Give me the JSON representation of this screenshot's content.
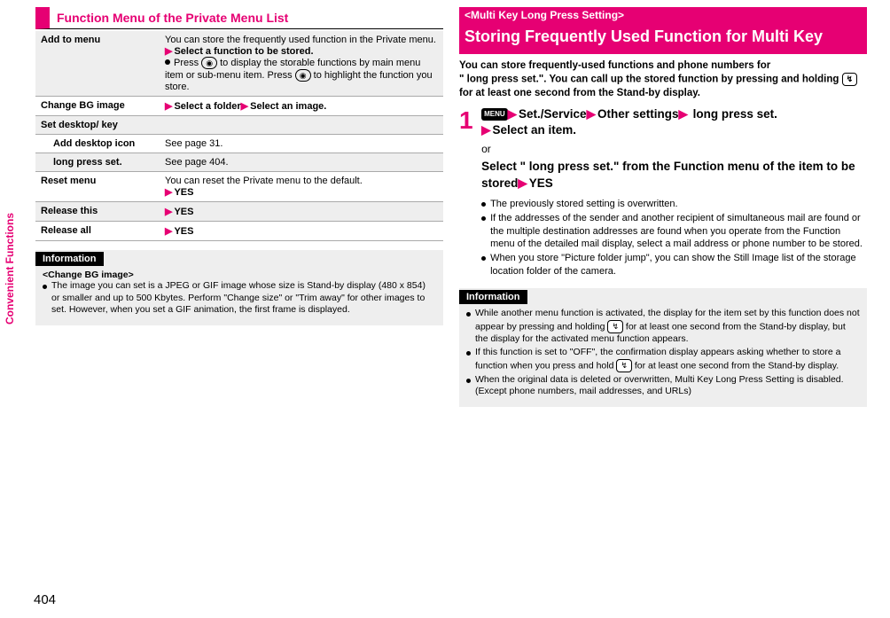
{
  "sidetab": "Convenient Functions",
  "pagenum": "404",
  "left": {
    "section_title": "Function Menu of the Private Menu List",
    "rows": {
      "r1_label": "Add to menu",
      "r1_desc1": "You can store the frequently used function in the Private menu.",
      "r1_action": "Select a function to be stored.",
      "r1_desc2a": "Press ",
      "r1_desc2b": " to display the storable functions by main menu item or sub-menu item. Press ",
      "r1_desc2c": " to highlight the function you store.",
      "r2_label": "Change BG image",
      "r2_act1": "Select a folder",
      "r2_act2": "Select an image.",
      "r3_label": "Set desktop/     key",
      "r3a_label": "Add desktop icon",
      "r3a_desc": "See page 31.",
      "r3b_label": "    long press set.",
      "r3b_desc": "See page 404.",
      "r4_label": "Reset menu",
      "r4_desc": "You can reset the Private menu to the default.",
      "r4_yes": "YES",
      "r5_label": "Release this",
      "r5_yes": "YES",
      "r6_label": "Release all",
      "r6_yes": "YES"
    },
    "info": {
      "tag": "Information",
      "sub": "<Change BG image>",
      "b1": "The image you can set is a JPEG or GIF image whose size is Stand-by display (480 x 854) or smaller and up to 500 Kbytes. Perform \"Change size\" or \"Trim away\" for other images to set. However, when you set a GIF animation, the first frame is displayed."
    }
  },
  "right": {
    "tag": "<Multi Key Long Press Setting>",
    "title": "Storing Frequently Used Function for Multi Key",
    "intro1": "You can store frequently-used functions and phone numbers for",
    "intro2": "\"     long press set.\". You can call up the stored function by pressing and holding ",
    "intro3": " for at least one second from the Stand-by display.",
    "step_num": "1",
    "menu_label": "MENU",
    "s1_a": "Set./Service",
    "s1_b": "Other settings",
    "s1_c": "    long press set.",
    "s1_d": "Select an item.",
    "or": "or",
    "s2_a": "Select \"    long press set.\" from the Function menu of the item to be stored",
    "s2_b": "YES",
    "bullets": {
      "b1": "The previously stored setting is overwritten.",
      "b2": "If the addresses of the sender and another recipient of simultaneous mail are found or the multiple destination addresses are found when you operate from the Function menu of the detailed mail display, select a mail address or phone number to be stored.",
      "b3": "When you store \"Picture folder jump\", you can show the Still Image list of the storage location folder of the camera."
    },
    "info": {
      "tag": "Information",
      "b1a": "While another menu function is activated, the display for the item set by this function does not appear by pressing and holding ",
      "b1b": " for at least one second from the Stand-by display, but the display for the activated menu function appears.",
      "b2a": "If this function is set to \"OFF\", the confirmation display appears asking whether to store a function when you press and hold ",
      "b2b": " for at least one second from the Stand-by display.",
      "b3": "When the original data is deleted or overwritten, Multi Key Long Press Setting is disabled. (Except phone numbers, mail addresses, and URLs)"
    }
  }
}
